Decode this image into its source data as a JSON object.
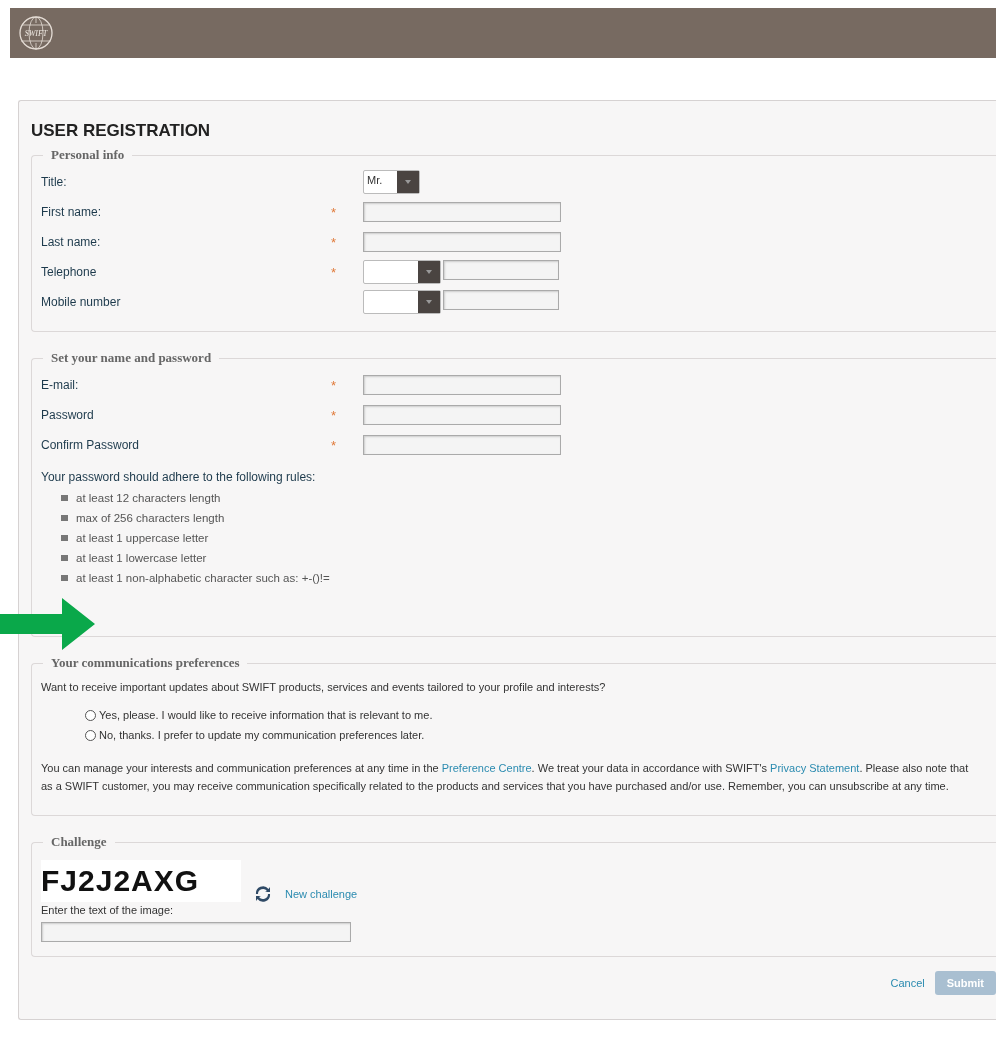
{
  "header": {
    "logo_text": "SWIFT"
  },
  "title": "USER REGISTRATION",
  "personal_info": {
    "legend": "Personal info",
    "fields": [
      {
        "label": "Title:",
        "kind": "select",
        "value": "Mr."
      },
      {
        "label": "First name:",
        "kind": "text",
        "required_mark": "*"
      },
      {
        "label": "Last name:",
        "kind": "text",
        "required_mark": "*"
      },
      {
        "label": "Telephone",
        "kind": "phone",
        "required_mark": "*"
      },
      {
        "label": "Mobile number",
        "kind": "phone"
      }
    ]
  },
  "credentials": {
    "legend": "Set your name and password",
    "fields": [
      {
        "label": "E-mail:",
        "kind": "text",
        "required_mark": "*"
      },
      {
        "label": "Password",
        "kind": "text",
        "required_mark": "*"
      },
      {
        "label": "Confirm Password",
        "kind": "text",
        "required_mark": "*"
      }
    ],
    "rules_intro": "Your password should adhere to the following rules:",
    "rules": [
      "at least 12 characters length",
      "max of 256 characters length",
      "at least 1 uppercase letter",
      "at least 1 lowercase letter",
      "at least 1 non-alphabetic character such as: +-()!="
    ]
  },
  "preferences": {
    "legend": "Your communications preferences",
    "question": "Want to receive important updates about SWIFT products, services and events tailored to your profile and interests?",
    "options": [
      {
        "label": "Yes, please. I would like to receive information that is relevant to me.",
        "selected": false
      },
      {
        "label": "No, thanks. I prefer to update my communication preferences later.",
        "selected": false
      }
    ],
    "notice": [
      {
        "kind": "text",
        "text": "You can manage your interests and communication preferences at any time in the "
      },
      {
        "kind": "link",
        "text": "Preference Centre"
      },
      {
        "kind": "text",
        "text": ". We treat your data in accordance with SWIFT's "
      },
      {
        "kind": "link",
        "text": "Privacy Statement"
      },
      {
        "kind": "text",
        "text": ". Please also note that as a SWIFT customer, you may receive communication specifically related to the products and services that you have purchased and/or use. Remember, you can unsubscribe at any time."
      }
    ]
  },
  "challenge": {
    "legend": "Challenge",
    "captcha": "FJ2J2AXG",
    "new_challenge": "New challenge",
    "prompt": "Enter the text of the image:"
  },
  "actions": {
    "cancel": "Cancel",
    "submit": {
      "label": "Submit",
      "disabled": true
    }
  }
}
